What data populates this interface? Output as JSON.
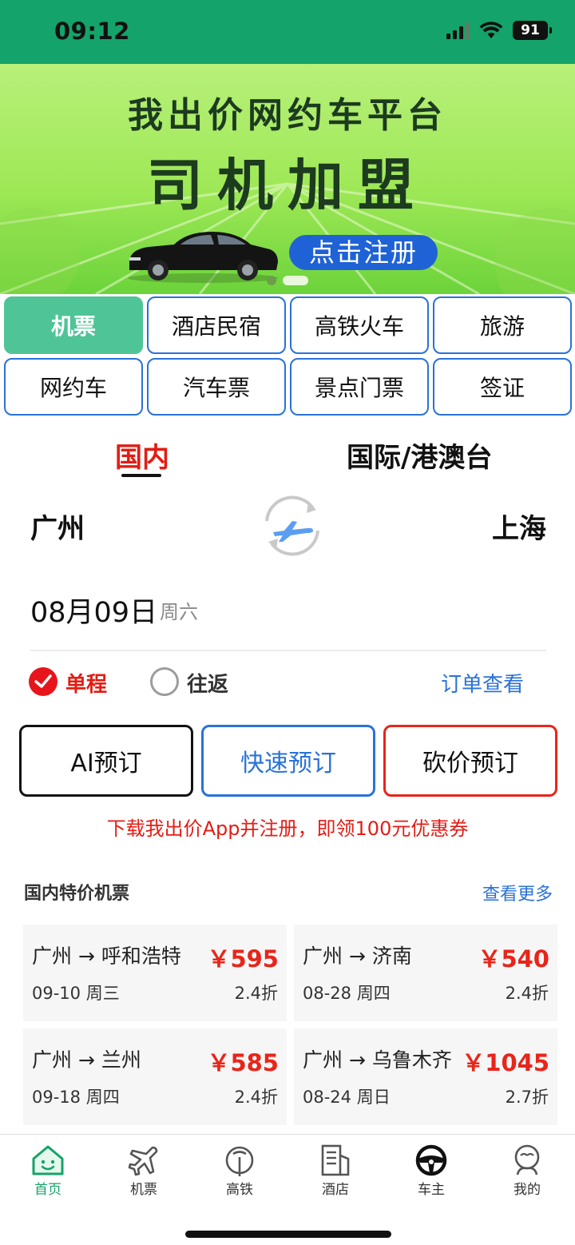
{
  "status_bar": {
    "time": "09:12",
    "battery": "91"
  },
  "banner": {
    "line1": "我出价网约车平台",
    "line2": "司机加盟",
    "button": "点击注册",
    "page_count": 2,
    "active_page": 2
  },
  "categories": [
    {
      "label": "机票",
      "active": true
    },
    {
      "label": "酒店民宿"
    },
    {
      "label": "高铁火车"
    },
    {
      "label": "旅游"
    },
    {
      "label": "网约车"
    },
    {
      "label": "汽车票"
    },
    {
      "label": "景点门票"
    },
    {
      "label": "签证"
    }
  ],
  "tabs": {
    "domestic": "国内",
    "international": "国际/港澳台",
    "active": "domestic"
  },
  "route": {
    "from": "广州",
    "to": "上海"
  },
  "date": {
    "value": "08月09日",
    "weekday": "周六"
  },
  "trip_type": {
    "one_way": "单程",
    "round_trip": "往返",
    "selected": "one_way",
    "order_link": "订单查看"
  },
  "actions": {
    "ai": "AI预订",
    "fast": "快速预订",
    "bargain": "砍价预订"
  },
  "promo": "下载我出价App并注册，即领100元优惠券",
  "deals": {
    "title": "国内特价机票",
    "more": "查看更多",
    "items": [
      {
        "route": "广州 → 呼和浩特",
        "price": "￥595",
        "date": "09-10 周三",
        "discount": "2.4折"
      },
      {
        "route": "广州 → 济南",
        "price": "￥540",
        "date": "08-28 周四",
        "discount": "2.4折"
      },
      {
        "route": "广州 → 兰州",
        "price": "￥585",
        "date": "09-18 周四",
        "discount": "2.4折"
      },
      {
        "route": "广州 → 乌鲁木齐",
        "price": "￥1045",
        "date": "08-24 周日",
        "discount": "2.7折"
      }
    ]
  },
  "bottom_nav": [
    {
      "label": "首页",
      "icon": "home-icon",
      "active": true
    },
    {
      "label": "机票",
      "icon": "plane-icon"
    },
    {
      "label": "高铁",
      "icon": "train-icon"
    },
    {
      "label": "酒店",
      "icon": "hotel-icon"
    },
    {
      "label": "车主",
      "icon": "steering-wheel-icon"
    },
    {
      "label": "我的",
      "icon": "profile-icon"
    }
  ],
  "colors": {
    "brand_green": "#14a36a",
    "accent_red": "#e21d14",
    "link_blue": "#2a72d8",
    "active_tab_green": "#4fc497"
  }
}
